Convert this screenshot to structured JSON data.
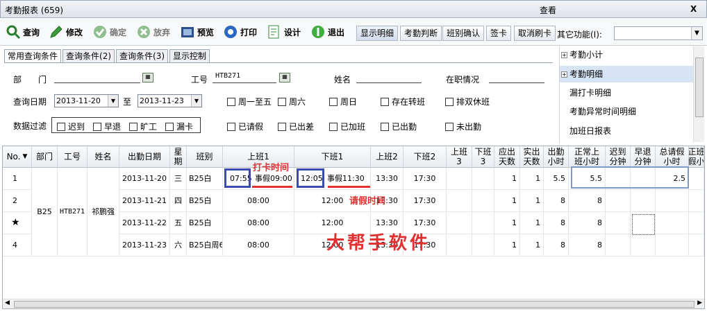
{
  "window": {
    "title": "考勤报表 (659)",
    "center": "查看",
    "close": "X"
  },
  "toolbar": {
    "query": "查询",
    "modify": "修改",
    "confirm": "确定",
    "abandon": "放弃",
    "preview": "预览",
    "print": "打印",
    "design": "设计",
    "exit": "退出",
    "show_detail": "显示明细",
    "judge": "考勤判断",
    "shift_confirm": "班别确认",
    "sign": "签卡",
    "cancel_swipe": "取消刷卡",
    "other_label": "其它功能(I):",
    "other_value": ""
  },
  "tabs": [
    "常用查询条件",
    "查询条件(2)",
    "查询条件(3)",
    "显示控制"
  ],
  "form": {
    "dept_label": "部　　门",
    "dept_value": "",
    "empno_label": "工号",
    "empno_value": "HTB271",
    "name_label": "姓名",
    "name_value": "",
    "status_label": "在职情况",
    "status_value": "",
    "date_label": "查询日期",
    "date_from": "2013-11-20",
    "to_label": "至",
    "date_to": "2013-11-23",
    "filter_label": "数据过滤",
    "checks_row1": [
      "周一至五",
      "周六",
      "周日",
      "存在转班",
      "排双休班"
    ],
    "filter_checks": [
      "迟到",
      "早退",
      "旷工",
      "漏卡"
    ],
    "checks_row2": [
      "已请假",
      "已出差",
      "已加班",
      "已出勤",
      "未出勤"
    ]
  },
  "reports": [
    {
      "label": "考勤小计",
      "expand": "+"
    },
    {
      "label": "考勤明细",
      "expand": "+"
    },
    {
      "label": "漏打卡明细",
      "expand": ""
    },
    {
      "label": "考勤异常时间明细",
      "expand": ""
    },
    {
      "label": "加班日报表",
      "expand": ""
    }
  ],
  "grid": {
    "headers": [
      "No.",
      "部门",
      "工号",
      "姓名",
      "出勤日期",
      "星\n期",
      "班别",
      "上班1",
      "下班1",
      "上班2",
      "下班2",
      "上班\n3",
      "下班\n3",
      "应出\n天数",
      "实出\n天数",
      "出勤\n小时",
      "正常上\n班小时",
      "迟到\n分钟",
      "早退\n分钟",
      "总请假\n小时",
      "正班\n假小"
    ],
    "group": {
      "dept": "B25",
      "empno": "HTB271",
      "name": "祁鹏强"
    },
    "rows": [
      {
        "no": "1",
        "date": "2013-11-20",
        "week": "三",
        "shift": "B25白",
        "in1a": "07:55",
        "in1b": "事假09:00",
        "out1a": "12:05",
        "out1b": "事假11:30",
        "in2": "13:30",
        "out2": "17:30",
        "need": "1",
        "real": "1",
        "hours": "5.5",
        "normal": "5.5",
        "late": "",
        "early": "",
        "leave": "2.5"
      },
      {
        "no": "2",
        "date": "2013-11-21",
        "week": "四",
        "shift": "B25白",
        "in1": "08:00",
        "out1": "12:00",
        "in2": "13:30",
        "out2": "17:30",
        "need": "1",
        "real": "1",
        "hours": "8",
        "normal": "8",
        "late": "",
        "early": "",
        "leave": ""
      },
      {
        "no": "★",
        "date": "2013-11-22",
        "week": "五",
        "shift": "B25白",
        "in1": "08:00",
        "out1": "12:00",
        "in2": "13:30",
        "out2": "17:30",
        "need": "1",
        "real": "1",
        "hours": "8",
        "normal": "8",
        "late": "",
        "early": "",
        "leave": ""
      },
      {
        "no": "4",
        "date": "2013-11-23",
        "week": "六",
        "shift": "B25白周6",
        "in1": "08:00",
        "out1": "12:00",
        "in2": "13:30",
        "out2": "17:30",
        "need": "1",
        "real": "1",
        "hours": "8",
        "normal": "8",
        "late": "",
        "early": "",
        "leave": ""
      }
    ]
  },
  "annotations": {
    "punch": "打卡时间",
    "leave": "请假时间",
    "watermark": "大帮手软件"
  },
  "colors": {
    "anno_blue": "#3a4cb0",
    "anno_red": "#e23030",
    "highlight": "#d6e4f5"
  }
}
